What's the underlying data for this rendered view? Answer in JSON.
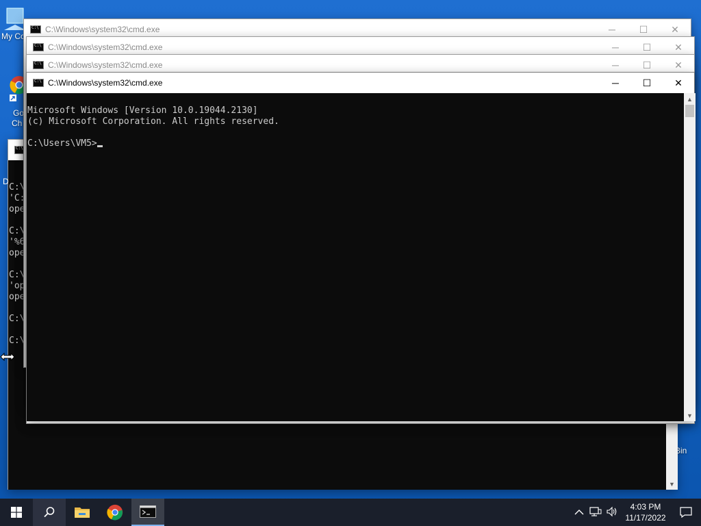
{
  "desktop": {
    "icons": [
      {
        "label": "My Co"
      },
      {
        "label": "Go"
      },
      {
        "label": "Ch"
      },
      {
        "label": "Bin"
      }
    ]
  },
  "windows": {
    "title": "C:\\Windows\\system32\\cmd.exe",
    "background_window": {
      "partial_letter": "D",
      "lines": [
        "C:\\",
        "'C:",
        "ope",
        "",
        "C:\\",
        "'%6",
        "ope",
        "",
        "C:\\",
        "'op",
        "ope",
        "",
        "C:\\",
        "",
        "C:\\"
      ]
    },
    "active": {
      "lines": [
        "Microsoft Windows [Version 10.0.19044.2130]",
        "(c) Microsoft Corporation. All rights reserved.",
        "",
        "C:\\Users\\VM5>"
      ]
    }
  },
  "controls": {
    "minimize": "─",
    "maximize": "☐",
    "close": "✕"
  },
  "taskbar": {
    "time": "4:03 PM",
    "date": "11/17/2022"
  },
  "colors": {
    "desktop": "#1565c8",
    "taskbar": "#1a1f2b",
    "console_bg": "#0c0c0c",
    "console_fg": "#cccccc"
  }
}
